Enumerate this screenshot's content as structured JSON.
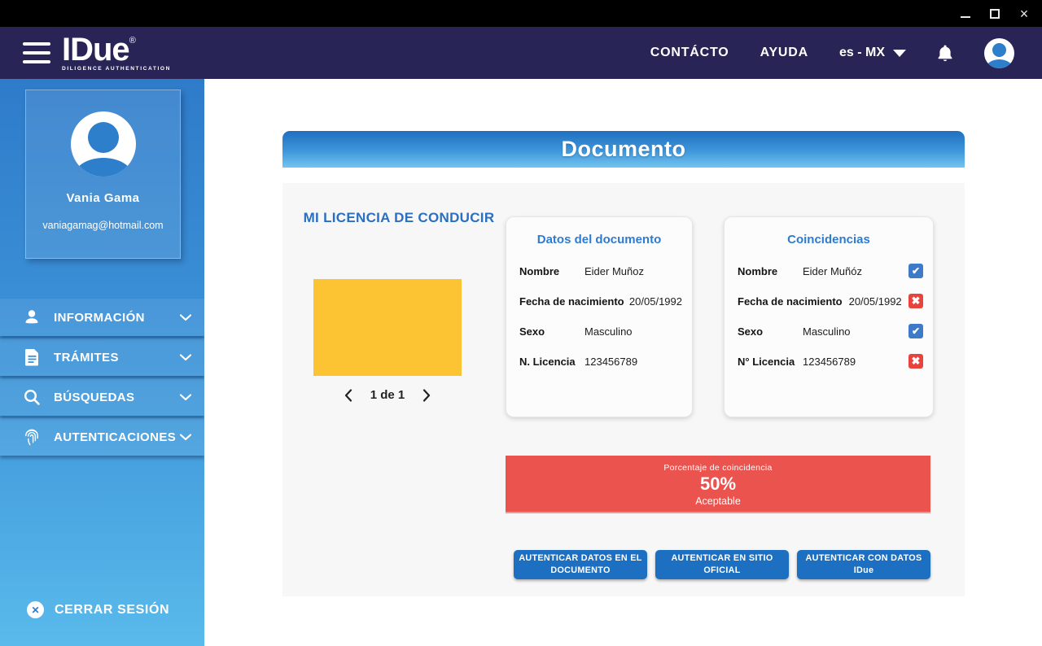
{
  "window": {
    "controls": {
      "minimize": "minimize",
      "maximize": "maximize",
      "close": "×"
    }
  },
  "appbar": {
    "logo": {
      "brand": "IDue",
      "registered": "®",
      "tagline": "DILIGENCE AUTHENTICATION"
    },
    "nav": {
      "contact": "CONTÁCTO",
      "help": "AYUDA"
    },
    "language": {
      "value": "es - MX"
    }
  },
  "sidebar": {
    "profile": {
      "name": "Vania Gama",
      "email": "vaniagamag@hotmail.com"
    },
    "items": [
      {
        "label": "INFORMACIÓN",
        "icon": "user-icon"
      },
      {
        "label": "TRÁMITES",
        "icon": "document-icon"
      },
      {
        "label": "BÚSQUEDAS",
        "icon": "search-icon"
      },
      {
        "label": "AUTENTICACIONES",
        "icon": "fingerprint-icon"
      }
    ],
    "logout": {
      "label": "CERRAR SESIÓN"
    }
  },
  "main": {
    "banner_title": "Documento",
    "document_viewer": {
      "title": "MI LICENCIA DE CONDUCIR",
      "pagination": "1 de 1"
    },
    "document_data": {
      "title": "Datos del documento",
      "rows": [
        {
          "label": "Nombre",
          "value": "Eider Muñoz"
        },
        {
          "label": "Fecha de nacimiento",
          "value": "20/05/1992"
        },
        {
          "label": "Sexo",
          "value": "Masculino"
        },
        {
          "label": "N. Licencia",
          "value": "123456789"
        }
      ]
    },
    "matches": {
      "title": "Coincidencias",
      "rows": [
        {
          "label": "Nombre",
          "value": "Eider Muñóz",
          "match": true
        },
        {
          "label": "Fecha de nacimiento",
          "value": "20/05/1992",
          "match": false
        },
        {
          "label": "Sexo",
          "value": "Masculino",
          "match": true
        },
        {
          "label": "N° Licencia",
          "value": "123456789",
          "match": false
        }
      ]
    },
    "match_summary": {
      "label": "Porcentaje de coincidencia",
      "percent": "50%",
      "status": "Aceptable"
    },
    "actions": [
      {
        "label": "AUTENTICAR DATOS EN EL DOCUMENTO"
      },
      {
        "label": "AUTENTICAR EN SITIO OFICIAL"
      },
      {
        "label": "AUTENTICAR CON DATOS IDue"
      }
    ]
  },
  "colors": {
    "titlebar": "#000000",
    "appbar": "#282456",
    "sidebar_gradient_top": "#2e7bca",
    "sidebar_gradient_bottom": "#5abaeb",
    "banner_gradient_top": "#1f6fc0",
    "banner_gradient_bottom": "#73c5ef",
    "panel_bg": "#f7f7f7",
    "card_title_blue": "#2e7bd0",
    "image_placeholder_yellow": "#fcc433",
    "match_yes_blue": "#3d7bc8",
    "match_no_red": "#e8443e",
    "summary_red": "#ea534e",
    "action_button_blue": "#1d6fc1"
  }
}
